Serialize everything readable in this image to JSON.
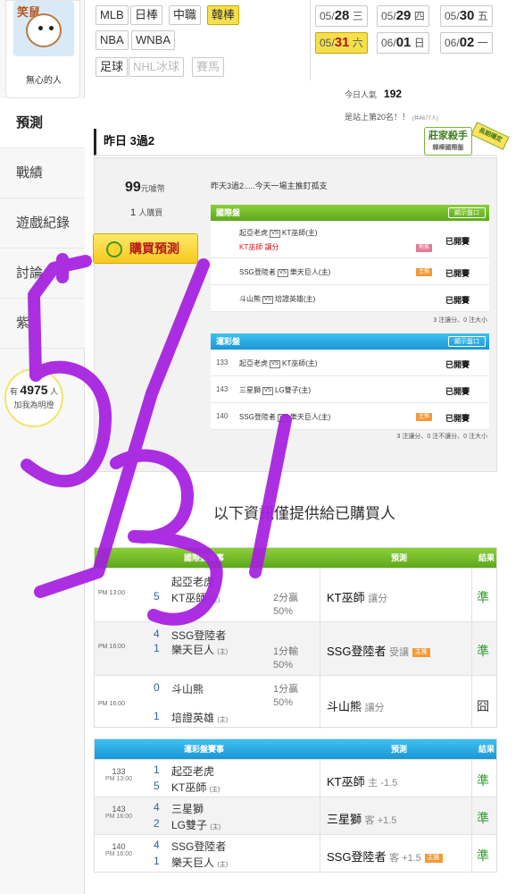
{
  "profile": {
    "avatar_text": "笑鼠",
    "name": "無心的人"
  },
  "sidebar": {
    "items": [
      {
        "label": "預測"
      },
      {
        "label": "戰績"
      },
      {
        "label": "遊戲紀錄"
      },
      {
        "label": "討論"
      },
      {
        "label": "紫"
      }
    ],
    "followers_prefix": "有",
    "followers_count": "4975",
    "followers_suffix": "人",
    "followers_cta": "加我為明燈"
  },
  "leagues": {
    "row1": [
      "MLB",
      "日棒",
      "中職",
      "韓棒"
    ],
    "row2": [
      "NBA",
      "WNBA"
    ],
    "row3": [
      "足球",
      "NHL冰球",
      "賽馬"
    ],
    "selected": "韓棒"
  },
  "dates": [
    {
      "md": "05/",
      "d": "28",
      "wd": "三"
    },
    {
      "md": "05/",
      "d": "29",
      "wd": "四"
    },
    {
      "md": "05/",
      "d": "30",
      "wd": "五"
    },
    {
      "md": "05/",
      "d": "31",
      "wd": "六"
    },
    {
      "md": "06/",
      "d": "01",
      "wd": "日"
    },
    {
      "md": "06/",
      "d": "02",
      "wd": "一"
    }
  ],
  "stats": {
    "popularity_label": "今日人氣",
    "popularity_value": "192",
    "rank_text": "是站上第20名！！",
    "rank_note": "(共4677人)"
  },
  "title": "昨日 3過2",
  "badge": {
    "main": "莊家殺手",
    "sub": "韓棒國際盤",
    "ribbon": "長期穩定"
  },
  "prediction": {
    "price": "99",
    "price_unit": "元噱幣",
    "buyers_count": "1",
    "buyers_unit": "人購買",
    "buy_label": "購買預測",
    "summary": "昨天3過2.....今天一場主推釘孤支"
  },
  "intl": {
    "header": "國際盤",
    "show_label": "顯示盤口",
    "rows": [
      {
        "away": "起亞老虎",
        "home": "KT巫師(主)",
        "pick": "KT巫師",
        "pick_note": "讓分",
        "tag": "熱推",
        "status": "已開賽"
      },
      {
        "away": "SSG登陸者",
        "home": "樂天巨人(主)",
        "pick": "",
        "pick_note": "",
        "tag": "主推",
        "status": "已開賽"
      },
      {
        "away": "斗山熊",
        "home": "培證英雄(主)",
        "pick": "",
        "pick_note": "",
        "tag": "",
        "status": "已開賽"
      }
    ],
    "footnote": "3 注讓分、0 注大小"
  },
  "lottery": {
    "header": "運彩盤",
    "show_label": "顯示盤口",
    "rows": [
      {
        "num": "133",
        "away": "起亞老虎",
        "home": "KT巫師(主)",
        "tag": "",
        "status": "已開賽"
      },
      {
        "num": "143",
        "away": "三星獅",
        "home": "LG雙子(主)",
        "tag": "",
        "status": "已開賽"
      },
      {
        "num": "140",
        "away": "SSG登陸者",
        "home": "樂天巨人(主)",
        "tag": "主推",
        "status": "已開賽"
      }
    ],
    "footnote": "3 注讓分、0 注不讓分、0 注大小"
  },
  "buyers_only_text": "以下資訊僅提供給已購買人",
  "vs_label": "VS",
  "intl_results": {
    "header_event": "國際盤賽事",
    "header_pick": "預測",
    "header_result": "結果",
    "rows": [
      {
        "time": "PM 13:00",
        "away_score": "",
        "away": "起亞老虎",
        "home_score": "5",
        "home": "KT巫師",
        "home_tag": "(主)",
        "line1": "2分贏",
        "line2": "50%",
        "pick": "KT巫師",
        "pick_note": "讓分",
        "pick_tag": "",
        "result": "準"
      },
      {
        "time": "PM 16:00",
        "away_score": "4",
        "away": "SSG登陸者",
        "home_score": "1",
        "home": "樂天巨人",
        "home_tag": "(主)",
        "line1": "1分輸",
        "line2": "50%",
        "pick": "SSG登陸者",
        "pick_note": "受讓",
        "pick_tag": "主推",
        "result": "準"
      },
      {
        "time": "PM 16:00",
        "away_score": "0",
        "away": "斗山熊",
        "home_score": "1",
        "home": "培證英雄",
        "home_tag": "(主)",
        "line1": "1分贏",
        "line2": "50%",
        "pick": "斗山熊",
        "pick_note": "讓分",
        "pick_tag": "",
        "result": "囧"
      }
    ]
  },
  "lottery_results": {
    "header_event": "運彩盤賽事",
    "header_pick": "預測",
    "header_result": "結果",
    "rows": [
      {
        "num": "133",
        "time": "PM 13:00",
        "away_score": "1",
        "away": "起亞老虎",
        "home_score": "5",
        "home": "KT巫師",
        "home_tag": "(主)",
        "pick": "KT巫師",
        "pick_note": "主 -1.5",
        "pick_tag": "",
        "result": "準"
      },
      {
        "num": "143",
        "time": "PM 16:00",
        "away_score": "4",
        "away": "三星獅",
        "home_score": "2",
        "home": "LG雙子",
        "home_tag": "(主)",
        "pick": "三星獅",
        "pick_note": "客 +1.5",
        "pick_tag": "",
        "result": "準"
      },
      {
        "num": "140",
        "time": "PM 16:00",
        "away_score": "4",
        "away": "SSG登陸者",
        "home_score": "1",
        "home": "樂天巨人",
        "home_tag": "(主)",
        "pick": "SSG登陸者",
        "pick_note": "客 +1.5",
        "pick_tag": "主推",
        "result": "準"
      }
    ]
  },
  "handwriting": "5/31",
  "colors": {
    "accent_green": "#5da81c",
    "accent_blue": "#1a97d6",
    "highlight_yellow": "#f5e04c",
    "scrawl_purple": "#a51de0",
    "win_green": "#2d9d2d"
  }
}
